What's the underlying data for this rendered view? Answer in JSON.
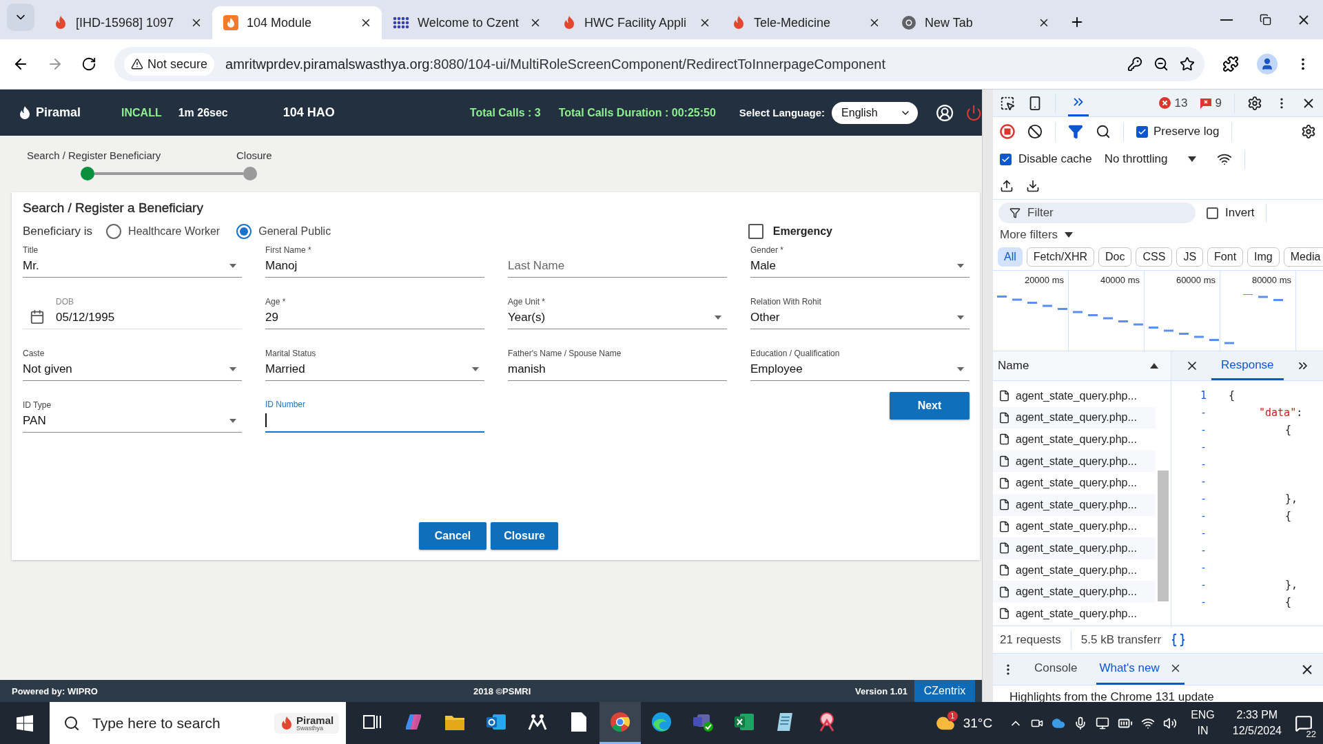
{
  "browser": {
    "tabs": [
      {
        "title": "[IHD-15968] 1097",
        "kind": "flame",
        "selected": false
      },
      {
        "title": "104 Module",
        "kind": "module",
        "selected": true
      },
      {
        "title": "Welcome to Czent",
        "kind": "dots",
        "selected": false
      },
      {
        "title": "HWC Facility Appli",
        "kind": "flame",
        "selected": false
      },
      {
        "title": "Tele-Medicine",
        "kind": "flame",
        "selected": false
      },
      {
        "title": "New Tab",
        "kind": "chrome",
        "selected": false
      }
    ],
    "security": "Not secure",
    "url_host": "amritwprdev.piramalswasthya.org",
    "url_path": ":8080/104-ui/MultiRoleScreenComponent/RedirectToInnerpageComponent"
  },
  "header": {
    "logo": "Piramal",
    "call_state": "INCALL",
    "call_time": "1m 26sec",
    "role": "104 HAO",
    "total_calls": "Total Calls : 3",
    "total_duration": "Total Calls Duration : 00:25:50",
    "language_label": "Select Language:",
    "language": "English"
  },
  "stepper": [
    {
      "label": "Search / Register Beneficiary",
      "done": true
    },
    {
      "label": "Closure",
      "done": false
    }
  ],
  "form": {
    "title": "Search / Register a Beneficiary",
    "beneficiary_label": "Beneficiary is",
    "beneficiary_options": [
      {
        "label": "Healthcare Worker",
        "selected": false
      },
      {
        "label": "General Public",
        "selected": true
      }
    ],
    "emergency": {
      "label": "Emergency",
      "checked": false
    },
    "fields": [
      {
        "kind": "select",
        "label": "Title",
        "value": "Mr.",
        "focused": false
      },
      {
        "kind": "text",
        "label": "First Name *",
        "value": "Manoj",
        "focused": false
      },
      {
        "kind": "text",
        "placeholder": "Last Name",
        "focused": false
      },
      {
        "kind": "select",
        "label": "Gender *",
        "value": "Male",
        "focused": false
      },
      {
        "kind": "date",
        "label": "DOB",
        "value": "05/12/1995",
        "focused": false
      },
      {
        "kind": "text",
        "label": "Age *",
        "value": "29",
        "focused": false
      },
      {
        "kind": "select",
        "label": "Age Unit *",
        "value": "Year(s)",
        "focused": false
      },
      {
        "kind": "select",
        "label": "Relation With Rohit",
        "value": "Other",
        "focused": false
      },
      {
        "kind": "select",
        "label": "Caste",
        "value": "Not given",
        "focused": false
      },
      {
        "kind": "select",
        "label": "Marital Status",
        "value": "Married",
        "focused": false
      },
      {
        "kind": "text",
        "label": "Father's Name / Spouse Name",
        "value": "manish",
        "focused": false
      },
      {
        "kind": "select",
        "label": "Education / Qualification",
        "value": "Employee",
        "focused": false
      },
      {
        "kind": "select",
        "label": "ID Type",
        "value": "PAN",
        "focused": false
      },
      {
        "kind": "text",
        "label": "ID Number",
        "focused": true
      }
    ],
    "next": "Next",
    "cancel": "Cancel",
    "closure": "Closure"
  },
  "footer": {
    "powered": "Powered by: WIPRO",
    "copyright": "2018 ©PSMRI",
    "version": "Version 1.01",
    "vendor": "CZentrix"
  },
  "devtools": {
    "errors": "13",
    "issues": "9",
    "preserve_log": {
      "label": "Preserve log",
      "checked": true
    },
    "disable_cache": {
      "label": "Disable cache",
      "checked": true
    },
    "throttling": "No throttling",
    "filter": {
      "placeholder": "Filter"
    },
    "invert": {
      "label": "Invert",
      "checked": false
    },
    "more_filters": "More filters",
    "type_filters": [
      {
        "label": "All",
        "selected": true
      },
      {
        "label": "Fetch/XHR",
        "selected": false
      },
      {
        "label": "Doc",
        "selected": false
      },
      {
        "label": "CSS",
        "selected": false
      },
      {
        "label": "JS",
        "selected": false
      },
      {
        "label": "Font",
        "selected": false
      },
      {
        "label": "Img",
        "selected": false
      },
      {
        "label": "Media",
        "selected": false
      }
    ],
    "timeline_ticks": [
      "20000 ms",
      "40000 ms",
      "60000 ms",
      "80000 ms"
    ],
    "name_header": "Name",
    "requests": [
      {
        "name": "agent_state_query.php..."
      },
      {
        "name": "agent_state_query.php..."
      },
      {
        "name": "agent_state_query.php..."
      },
      {
        "name": "agent_state_query.php..."
      },
      {
        "name": "agent_state_query.php..."
      },
      {
        "name": "agent_state_query.php..."
      },
      {
        "name": "agent_state_query.php..."
      },
      {
        "name": "agent_state_query.php..."
      },
      {
        "name": "agent_state_query.php..."
      },
      {
        "name": "agent_state_query.php..."
      },
      {
        "name": "agent_state_query.php..."
      }
    ],
    "detail_tabs": [
      {
        "label": "Response",
        "selected": true
      }
    ],
    "code": [
      {
        "number": "1",
        "kind": "root",
        "text": "{"
      },
      {
        "number": "-",
        "kind": "key",
        "key": "\"data\"",
        "text": ":"
      },
      {
        "number": "-",
        "kind": "item",
        "text": "{"
      },
      {
        "number": "-",
        "kind": "blank"
      },
      {
        "number": "-",
        "kind": "blank"
      },
      {
        "number": "-",
        "kind": "blank"
      },
      {
        "number": "-",
        "kind": "item",
        "text": "},"
      },
      {
        "number": "-",
        "kind": "item",
        "text": "{"
      },
      {
        "number": "-",
        "kind": "blank"
      },
      {
        "number": "-",
        "kind": "blank"
      },
      {
        "number": "-",
        "kind": "blank"
      },
      {
        "number": "-",
        "kind": "item",
        "text": "},"
      },
      {
        "number": "-",
        "kind": "item",
        "text": "{"
      }
    ],
    "summary_requests": "21 requests",
    "summary_transfer": "5.5 kB transferr",
    "drawer_tabs": [
      {
        "label": "Console",
        "selected": false
      },
      {
        "label": "What's new",
        "selected": true
      }
    ],
    "highlights": "Highlights from the Chrome 131 update"
  },
  "taskbar": {
    "search_placeholder": "Type here to search",
    "search_logo": "Piramal",
    "search_logo_sub": "Swasthya",
    "apps": [
      {
        "kind": "taskview",
        "selected": false
      },
      {
        "kind": "copilot",
        "selected": false
      },
      {
        "kind": "explorer",
        "selected": false
      },
      {
        "kind": "outlook",
        "selected": false
      },
      {
        "kind": "people",
        "selected": false
      },
      {
        "kind": "file",
        "selected": false
      },
      {
        "kind": "chrome",
        "selected": true
      },
      {
        "kind": "edge",
        "selected": false
      },
      {
        "kind": "teams",
        "selected": false
      },
      {
        "kind": "excel",
        "selected": false
      },
      {
        "kind": "notepad",
        "selected": false
      },
      {
        "kind": "snip",
        "selected": false
      }
    ],
    "weather_badge": "1",
    "temperature": "31°C",
    "language": "ENG",
    "region": "IN",
    "time": "2:33 PM",
    "date": "12/5/2024",
    "notifications": "22"
  }
}
